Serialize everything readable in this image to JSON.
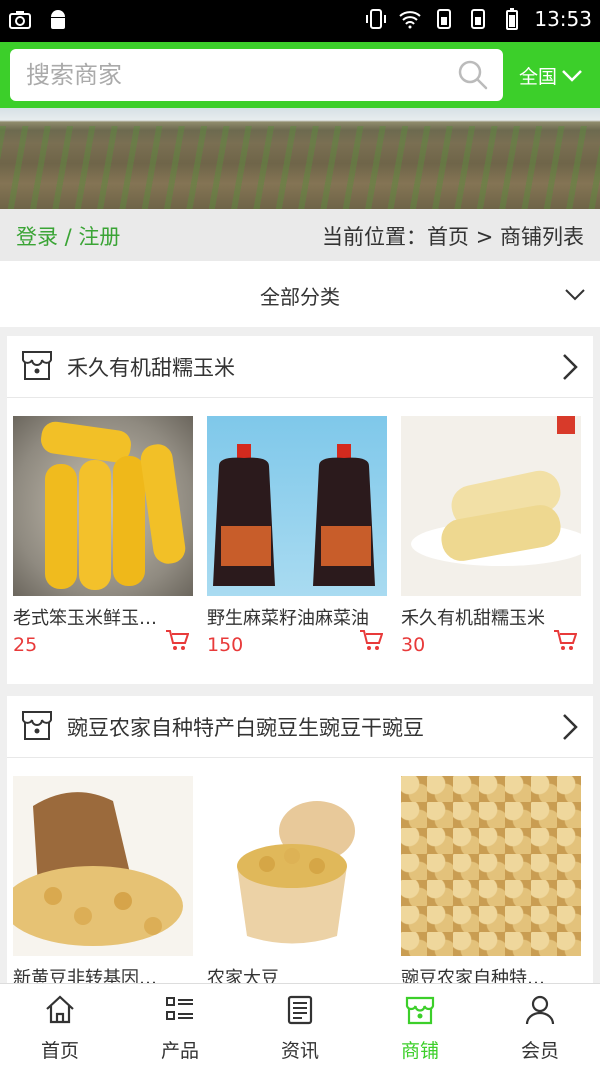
{
  "status_bar": {
    "time": "13:53"
  },
  "header": {
    "search_placeholder": "搜索商家",
    "region_label": "全国"
  },
  "breadcrumb": {
    "login_label": "登录 / 注册",
    "location_text": "当前位置：首页 > 商铺列表"
  },
  "category": {
    "label": "全部分类"
  },
  "shops": [
    {
      "name": "禾久有机甜糯玉米",
      "products": [
        {
          "name": "老式笨玉米鲜玉…",
          "price": "25"
        },
        {
          "name": "野生麻菜籽油麻菜油",
          "price": "150"
        },
        {
          "name": "禾久有机甜糯玉米",
          "price": "30"
        }
      ]
    },
    {
      "name": "豌豆农家自种特产白豌豆生豌豆干豌豆",
      "products": [
        {
          "name": "新黄豆非转基因…",
          "price": ""
        },
        {
          "name": "农家大豆",
          "price": ""
        },
        {
          "name": "豌豆农家自种特…",
          "price": ""
        }
      ]
    }
  ],
  "tabbar": {
    "items": [
      {
        "label": "首页",
        "icon": "home-icon"
      },
      {
        "label": "产品",
        "icon": "list-icon"
      },
      {
        "label": "资讯",
        "icon": "news-icon"
      },
      {
        "label": "商铺",
        "icon": "store-icon"
      },
      {
        "label": "会员",
        "icon": "user-icon"
      }
    ],
    "active_index": 3
  },
  "colors": {
    "accent": "#3ccf2a",
    "price": "#e83a3a",
    "link": "#3aa435"
  }
}
